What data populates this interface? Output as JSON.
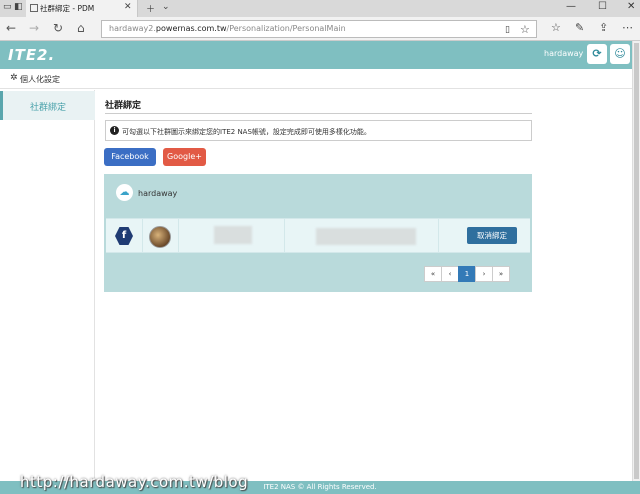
{
  "browser": {
    "tab_title": "社群綁定 - PDM",
    "url_pre": "hardaway2.",
    "url_host": "powernas.com.tw",
    "url_path": "/Personalization/PersonalMain"
  },
  "header": {
    "logo": "ITE2.",
    "username": "hardaway"
  },
  "settings": {
    "label": "個人化設定"
  },
  "sidebar": {
    "items": [
      {
        "label": "社群綁定"
      }
    ]
  },
  "main": {
    "title": "社群綁定",
    "notice": "可勾選以下社群圖示來綁定您的ITE2 NAS帳號，設定完成即可使用多樣化功能。",
    "buttons": {
      "facebook": "Facebook",
      "google": "Google+"
    },
    "panel": {
      "user": "hardaway",
      "row": {
        "unbind": "取消綁定"
      },
      "pager": {
        "first": "«",
        "prev": "‹",
        "page": "1",
        "next": "›",
        "last": "»"
      }
    }
  },
  "footer": {
    "text": "ITE2 NAS © All Rights Reserved."
  },
  "watermark": "http://hardaway.com.tw/blog",
  "colors": {
    "header_bg": "#7fbfc1",
    "panel_bg": "#b9dadb",
    "facebook": "#3b6ec4",
    "google": "#e25a45",
    "accent": "#4ba2ab"
  }
}
